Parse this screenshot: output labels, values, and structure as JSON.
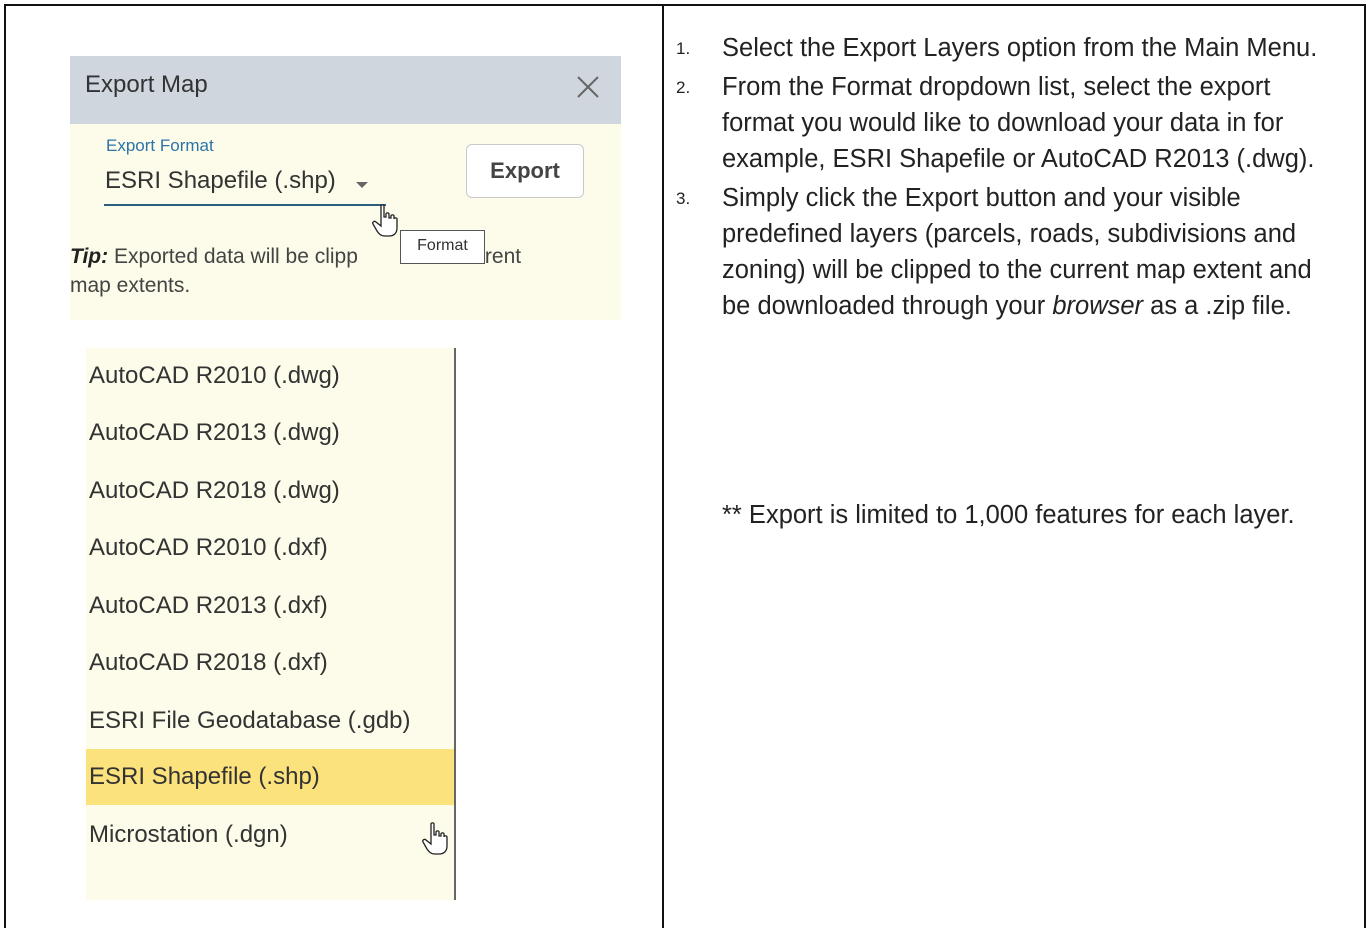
{
  "dialog": {
    "title": "Export Map",
    "format_label": "Export Format",
    "format_value": "ESRI Shapefile (.shp)",
    "export_button": "Export",
    "tip_label": "Tip:",
    "tip_text_before": " Exported data will be clipp",
    "tip_text_after": " current",
    "tip_text_line2": "map extents.",
    "tooltip": "Format"
  },
  "format_options": [
    "AutoCAD R2010 (.dwg)",
    "AutoCAD R2013 (.dwg)",
    "AutoCAD R2018 (.dwg)",
    "AutoCAD R2010 (.dxf)",
    "AutoCAD R2013 (.dxf)",
    "AutoCAD R2018 (.dxf)",
    "ESRI File Geodatabase (.gdb)",
    "ESRI Shapefile (.shp)",
    "Microstation (.dgn)"
  ],
  "selected_option_index": 7,
  "instructions": {
    "steps": [
      {
        "num": "1.",
        "text": "Select the Export Layers option from the Main Menu."
      },
      {
        "num": "2.",
        "text": "From the Format dropdown list, select the export format you would like to download your data in for example, ESRI Shapefile or AutoCAD R2013 (.dwg)."
      },
      {
        "num": "3.",
        "text_before": "Simply click the Export button and your visible predefined layers (parcels, roads, subdivisions and zoning) will be clipped to the current map extent and be downloaded through your ",
        "text_italic": "browser",
        "text_after": " as a .zip file."
      }
    ],
    "note": "** Export is limited to 1,000 features for each layer."
  },
  "colors": {
    "panel_header": "#cfd6de",
    "panel_body": "#fdfbe9",
    "selected_highlight": "#fbe27c",
    "format_label": "#2b74a8"
  }
}
